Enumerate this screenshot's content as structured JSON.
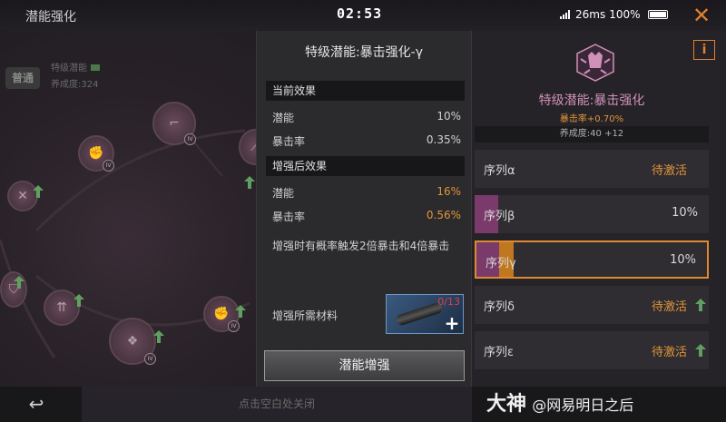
{
  "topbar": {
    "title": "潜能强化",
    "clock": "02:53",
    "ping": "26ms",
    "battery": "100%",
    "close_glyph": "✕"
  },
  "tree": {
    "rank_badge": "普通",
    "rank_name": "特级潜能",
    "rank_progress": "养成度:324",
    "nodes": [
      {
        "icon": "gun-skill-icon",
        "badge": "IV"
      },
      {
        "icon": "fist-skill-icon",
        "badge": "IV"
      },
      {
        "icon": "slash-skill-icon",
        "badge": ""
      },
      {
        "icon": "crossed-arrows-icon",
        "badge": ""
      },
      {
        "icon": "shield-skill-icon",
        "badge": ""
      },
      {
        "icon": "arrows-up-icon",
        "badge": ""
      },
      {
        "icon": "crit-fist-icon",
        "badge": "IV"
      },
      {
        "icon": "bear-skill-icon",
        "badge": "IV"
      }
    ]
  },
  "detail": {
    "title": "特级潜能:暴击强化-γ",
    "current_header": "当前效果",
    "current_rows": [
      {
        "name": "潜能",
        "value": "10%"
      },
      {
        "name": "暴击率",
        "value": "0.35%"
      }
    ],
    "after_header": "增强后效果",
    "after_rows": [
      {
        "name": "潜能",
        "value": "16%"
      },
      {
        "name": "暴击率",
        "value": "0.56%"
      }
    ],
    "description": "增强时有概率触发2倍暴击和4倍暴击",
    "material_label": "增强所需材料",
    "material_count": "0/13",
    "enhance_button": "潜能增强"
  },
  "right": {
    "info_glyph": "i",
    "skill_name": "特级潜能:暴击强化",
    "skill_bonus": "暴击率+0.70%",
    "skill_progress": "养成度:40  +12",
    "sequences": [
      {
        "label": "序列α",
        "value": "待激活",
        "status": "inactive",
        "progress": 0
      },
      {
        "label": "序列β",
        "value": "10%",
        "status": "active",
        "progress": 0.1
      },
      {
        "label": "序列γ",
        "value": "10%",
        "status": "selected",
        "progress": 0.1
      },
      {
        "label": "序列δ",
        "value": "待激活",
        "status": "inactive",
        "progress": 0
      },
      {
        "label": "序列ε",
        "value": "待激活",
        "status": "inactive",
        "progress": 0
      }
    ],
    "accent_color": "#e08a30",
    "fill_color": "#7a3a6a",
    "preview_color": "#c07820"
  },
  "bottom": {
    "back_glyph": "↩",
    "hint": "点击空白处关闭",
    "watermark_brand": "大神",
    "watermark_handle": "@网易明日之后"
  }
}
